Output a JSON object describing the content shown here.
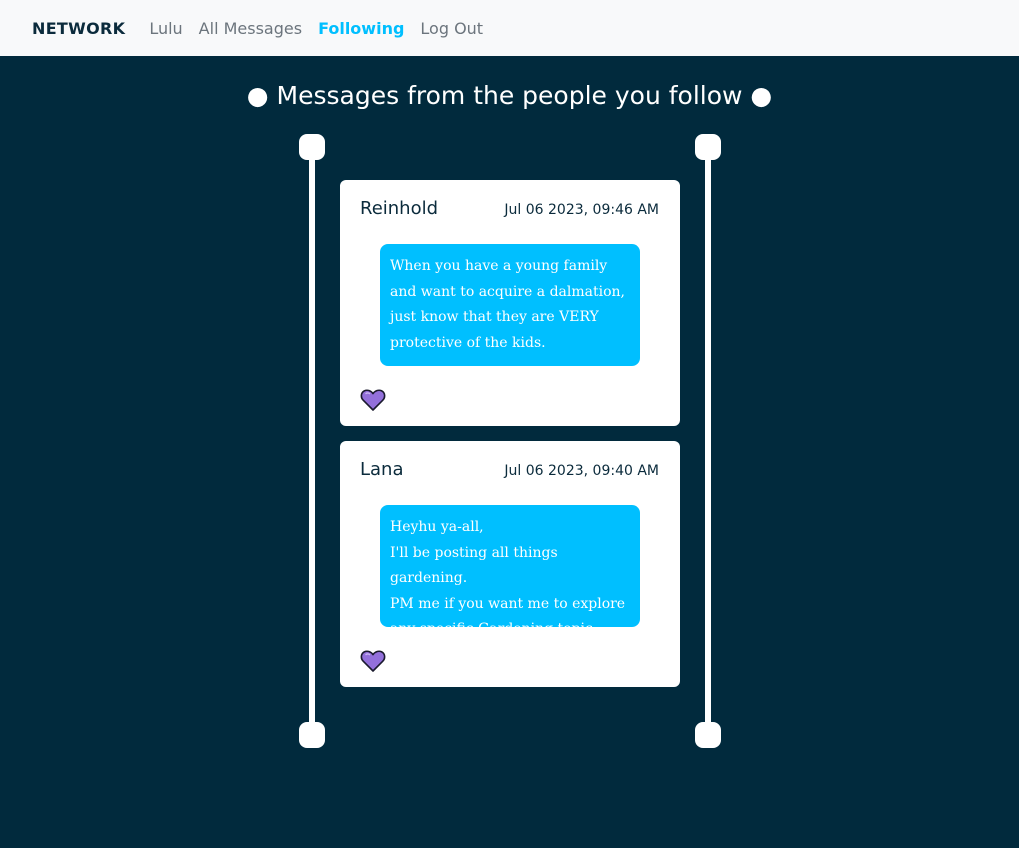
{
  "navbar": {
    "brand": "NETWORK",
    "links": [
      {
        "label": "Lulu",
        "active": false
      },
      {
        "label": "All Messages",
        "active": false
      },
      {
        "label": "Following",
        "active": true
      },
      {
        "label": "Log Out",
        "active": false
      }
    ]
  },
  "page": {
    "title": "● Messages from the people you follow ●"
  },
  "posts": [
    {
      "user": "Reinhold",
      "timestamp": "Jul 06 2023, 09:46 AM",
      "content": "When you have a young family and want to acquire a dalmation, just know that they are VERY protective of the kids.",
      "like_icon": "heart-icon"
    },
    {
      "user": "Lana",
      "timestamp": "Jul 06 2023, 09:40 AM",
      "content": "Heyhu ya-all,\nI'll be posting all things gardening.\nPM me if you want me to explore any specific Gardening topic.",
      "like_icon": "heart-icon"
    }
  ],
  "colors": {
    "background": "#012a3d",
    "accent": "#00bfff",
    "heart": "#9370db"
  }
}
